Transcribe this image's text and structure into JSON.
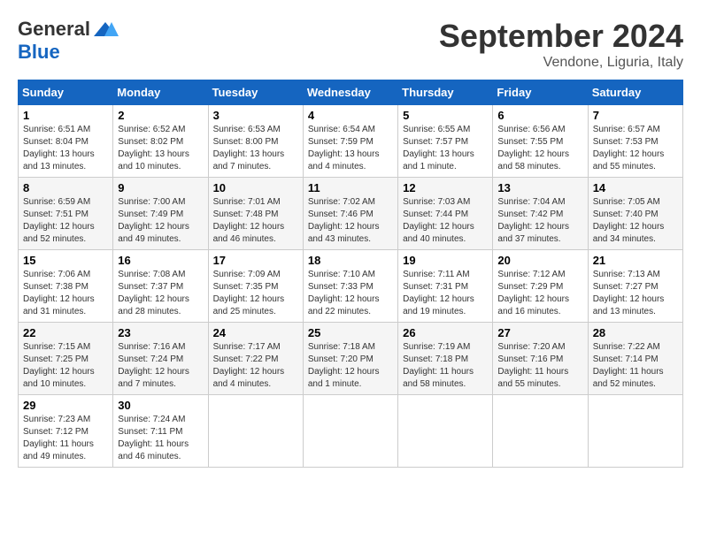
{
  "logo": {
    "general": "General",
    "blue": "Blue"
  },
  "title": "September 2024",
  "location": "Vendone, Liguria, Italy",
  "headers": [
    "Sunday",
    "Monday",
    "Tuesday",
    "Wednesday",
    "Thursday",
    "Friday",
    "Saturday"
  ],
  "weeks": [
    [
      {
        "day": "1",
        "info": "Sunrise: 6:51 AM\nSunset: 8:04 PM\nDaylight: 13 hours\nand 13 minutes."
      },
      {
        "day": "2",
        "info": "Sunrise: 6:52 AM\nSunset: 8:02 PM\nDaylight: 13 hours\nand 10 minutes."
      },
      {
        "day": "3",
        "info": "Sunrise: 6:53 AM\nSunset: 8:00 PM\nDaylight: 13 hours\nand 7 minutes."
      },
      {
        "day": "4",
        "info": "Sunrise: 6:54 AM\nSunset: 7:59 PM\nDaylight: 13 hours\nand 4 minutes."
      },
      {
        "day": "5",
        "info": "Sunrise: 6:55 AM\nSunset: 7:57 PM\nDaylight: 13 hours\nand 1 minute."
      },
      {
        "day": "6",
        "info": "Sunrise: 6:56 AM\nSunset: 7:55 PM\nDaylight: 12 hours\nand 58 minutes."
      },
      {
        "day": "7",
        "info": "Sunrise: 6:57 AM\nSunset: 7:53 PM\nDaylight: 12 hours\nand 55 minutes."
      }
    ],
    [
      {
        "day": "8",
        "info": "Sunrise: 6:59 AM\nSunset: 7:51 PM\nDaylight: 12 hours\nand 52 minutes."
      },
      {
        "day": "9",
        "info": "Sunrise: 7:00 AM\nSunset: 7:49 PM\nDaylight: 12 hours\nand 49 minutes."
      },
      {
        "day": "10",
        "info": "Sunrise: 7:01 AM\nSunset: 7:48 PM\nDaylight: 12 hours\nand 46 minutes."
      },
      {
        "day": "11",
        "info": "Sunrise: 7:02 AM\nSunset: 7:46 PM\nDaylight: 12 hours\nand 43 minutes."
      },
      {
        "day": "12",
        "info": "Sunrise: 7:03 AM\nSunset: 7:44 PM\nDaylight: 12 hours\nand 40 minutes."
      },
      {
        "day": "13",
        "info": "Sunrise: 7:04 AM\nSunset: 7:42 PM\nDaylight: 12 hours\nand 37 minutes."
      },
      {
        "day": "14",
        "info": "Sunrise: 7:05 AM\nSunset: 7:40 PM\nDaylight: 12 hours\nand 34 minutes."
      }
    ],
    [
      {
        "day": "15",
        "info": "Sunrise: 7:06 AM\nSunset: 7:38 PM\nDaylight: 12 hours\nand 31 minutes."
      },
      {
        "day": "16",
        "info": "Sunrise: 7:08 AM\nSunset: 7:37 PM\nDaylight: 12 hours\nand 28 minutes."
      },
      {
        "day": "17",
        "info": "Sunrise: 7:09 AM\nSunset: 7:35 PM\nDaylight: 12 hours\nand 25 minutes."
      },
      {
        "day": "18",
        "info": "Sunrise: 7:10 AM\nSunset: 7:33 PM\nDaylight: 12 hours\nand 22 minutes."
      },
      {
        "day": "19",
        "info": "Sunrise: 7:11 AM\nSunset: 7:31 PM\nDaylight: 12 hours\nand 19 minutes."
      },
      {
        "day": "20",
        "info": "Sunrise: 7:12 AM\nSunset: 7:29 PM\nDaylight: 12 hours\nand 16 minutes."
      },
      {
        "day": "21",
        "info": "Sunrise: 7:13 AM\nSunset: 7:27 PM\nDaylight: 12 hours\nand 13 minutes."
      }
    ],
    [
      {
        "day": "22",
        "info": "Sunrise: 7:15 AM\nSunset: 7:25 PM\nDaylight: 12 hours\nand 10 minutes."
      },
      {
        "day": "23",
        "info": "Sunrise: 7:16 AM\nSunset: 7:24 PM\nDaylight: 12 hours\nand 7 minutes."
      },
      {
        "day": "24",
        "info": "Sunrise: 7:17 AM\nSunset: 7:22 PM\nDaylight: 12 hours\nand 4 minutes."
      },
      {
        "day": "25",
        "info": "Sunrise: 7:18 AM\nSunset: 7:20 PM\nDaylight: 12 hours\nand 1 minute."
      },
      {
        "day": "26",
        "info": "Sunrise: 7:19 AM\nSunset: 7:18 PM\nDaylight: 11 hours\nand 58 minutes."
      },
      {
        "day": "27",
        "info": "Sunrise: 7:20 AM\nSunset: 7:16 PM\nDaylight: 11 hours\nand 55 minutes."
      },
      {
        "day": "28",
        "info": "Sunrise: 7:22 AM\nSunset: 7:14 PM\nDaylight: 11 hours\nand 52 minutes."
      }
    ],
    [
      {
        "day": "29",
        "info": "Sunrise: 7:23 AM\nSunset: 7:12 PM\nDaylight: 11 hours\nand 49 minutes."
      },
      {
        "day": "30",
        "info": "Sunrise: 7:24 AM\nSunset: 7:11 PM\nDaylight: 11 hours\nand 46 minutes."
      },
      {
        "day": "",
        "info": ""
      },
      {
        "day": "",
        "info": ""
      },
      {
        "day": "",
        "info": ""
      },
      {
        "day": "",
        "info": ""
      },
      {
        "day": "",
        "info": ""
      }
    ]
  ]
}
